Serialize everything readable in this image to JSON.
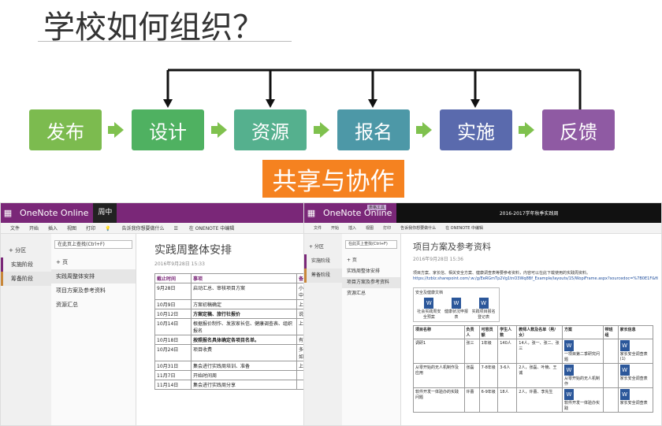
{
  "slide": {
    "title": "学校如何组织？",
    "steps": [
      {
        "label": "发布",
        "color": "#7cbb4f"
      },
      {
        "label": "设计",
        "color": "#4fb161"
      },
      {
        "label": "资源",
        "color": "#55b08e"
      },
      {
        "label": "报名",
        "color": "#4d98a7"
      },
      {
        "label": "实施",
        "color": "#5a6aad"
      },
      {
        "label": "反馈",
        "color": "#8f5aa3"
      }
    ],
    "share_label": "共享与协作",
    "share_color": "#f58220",
    "arrow_color": "#7fc14e"
  },
  "shot1": {
    "app_name": "OneNote Online",
    "user": "周中",
    "ribbon": [
      "文件",
      "开始",
      "插入",
      "视图",
      "打印",
      "告诉我你想要做什么",
      "在 ONENOTE 中编辑"
    ],
    "add_section": "+ 分区",
    "sections": [
      "实施阶段",
      "筹备阶段"
    ],
    "search_placeholder": "在此页上查找(Ctrl+F)",
    "add_page": "+ 页",
    "pages": [
      "实践周整体安排",
      "项目方案及参考资料",
      "资源汇总"
    ],
    "page_title": "实践周整体安排",
    "page_date": "2016年9月28日     15:33",
    "table_headers": [
      "截止时间",
      "事项",
      "备"
    ],
    "rows": [
      [
        "9月28日",
        "启动汇总、审核项目方案",
        "小体中"
      ],
      [
        "10月9日",
        "方案初稿确定",
        "上"
      ],
      [
        "10月12日",
        "方案定稿、旅行社报价",
        "说明"
      ],
      [
        "10月14日",
        "根据报价制作、发放家长信、健康调查表、组织报名",
        "上"
      ],
      [
        "10月18日",
        "按照报名具体确定各项目名单。",
        "有料"
      ],
      [
        "10月24日",
        "项目收费",
        "多的如"
      ],
      [
        "10月31日",
        "集会进行实践周培训、准备",
        "上"
      ],
      [
        "11月7日",
        "开始时间周",
        ""
      ],
      [
        "11月14日",
        "集会进行实践周分享",
        ""
      ]
    ]
  },
  "shot2": {
    "app_name": "OneNote Online",
    "window_title": "2016-2017学年秋季实践周",
    "ribbon": [
      "文件",
      "开始",
      "插入",
      "视图",
      "打印",
      "告诉我你想要做什么",
      "在 ONENOTE 中编辑"
    ],
    "tool_tag": "表格工具",
    "sections": [
      "实施阶段",
      "筹备阶段"
    ],
    "add_section": "+ 分区",
    "search_placeholder": "在此页上查找(Ctrl+F)",
    "add_page": "+ 页",
    "pages": [
      "实践周整体安排",
      "项目方案及参考资料",
      "资源汇总"
    ],
    "page_title": "项目方案及参考资料",
    "page_date": "2016年9月28日     15:36",
    "note": "项目方案、家长信、相关安全方案、健康调查表等要参考资料，内容可以在此下载使用的实践周资料。",
    "link": "https://tzblz.sharepoint.com/:w:/g/EeRGmTp2Vg1tnO3Wq8Bf_Example/layouts/15/WopiFrame.aspx?sourcedoc=%7B0E1F&file=实践周资料",
    "doc_block_title": "安全及健康文档",
    "docs": [
      "社会实践周安全预案",
      "健康状况申报表",
      "实践项目报名登记表"
    ],
    "headers": [
      "项目名称",
      "负责人",
      "可容员额",
      "学生人数",
      "教师人数及名单（男/女）",
      "方案",
      "带班组",
      "家长信息"
    ],
    "rows": [
      [
        "调研1",
        "张三",
        "1年级",
        "140人",
        "14人，张一、张二、张三",
        "一项目第二季研究问题",
        "",
        "家长安全调查表(1)"
      ],
      [
        "从零开始的无人机制作及应用",
        "张磊",
        "7-8年级",
        "3-6人",
        "2人，张磊、叶楠、王诚",
        "从零开始的无人机制作",
        "",
        "家长安全调查表"
      ],
      [
        "软件开发一体验办的实践问题",
        "许蕾",
        "6-9年级",
        "18人",
        "2人，许蕾、李先生",
        "软件开发一体验办实践",
        "",
        "家长安全调查表"
      ]
    ]
  }
}
